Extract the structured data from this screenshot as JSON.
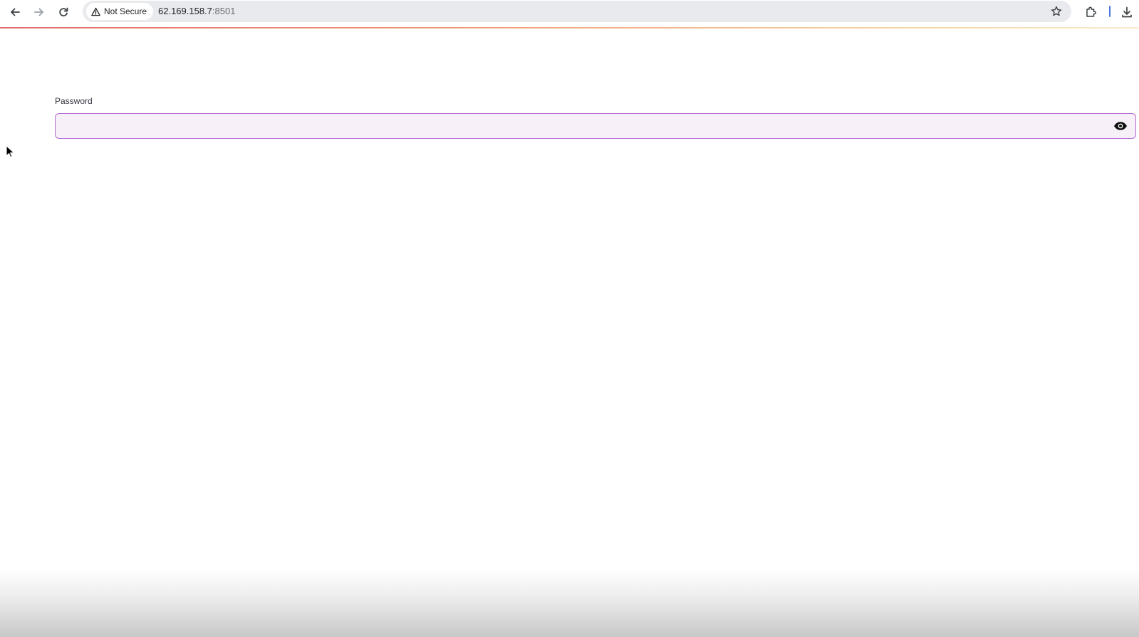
{
  "browser": {
    "security_label": "Not Secure",
    "url_host": "62.169.158.7",
    "url_port": ":8501",
    "icons": {
      "back": "back-arrow-icon",
      "forward": "forward-arrow-icon",
      "reload": "reload-icon",
      "warning": "warning-triangle-icon",
      "bookmark": "star-icon",
      "extensions": "puzzle-icon",
      "download": "download-icon"
    }
  },
  "colors": {
    "accent_border": "#b46ad6",
    "input_background": "#f7f0f9",
    "label_text": "#31333f"
  },
  "form": {
    "password_label": "Password",
    "password_value": "",
    "toggle_icon": "eye-icon"
  }
}
